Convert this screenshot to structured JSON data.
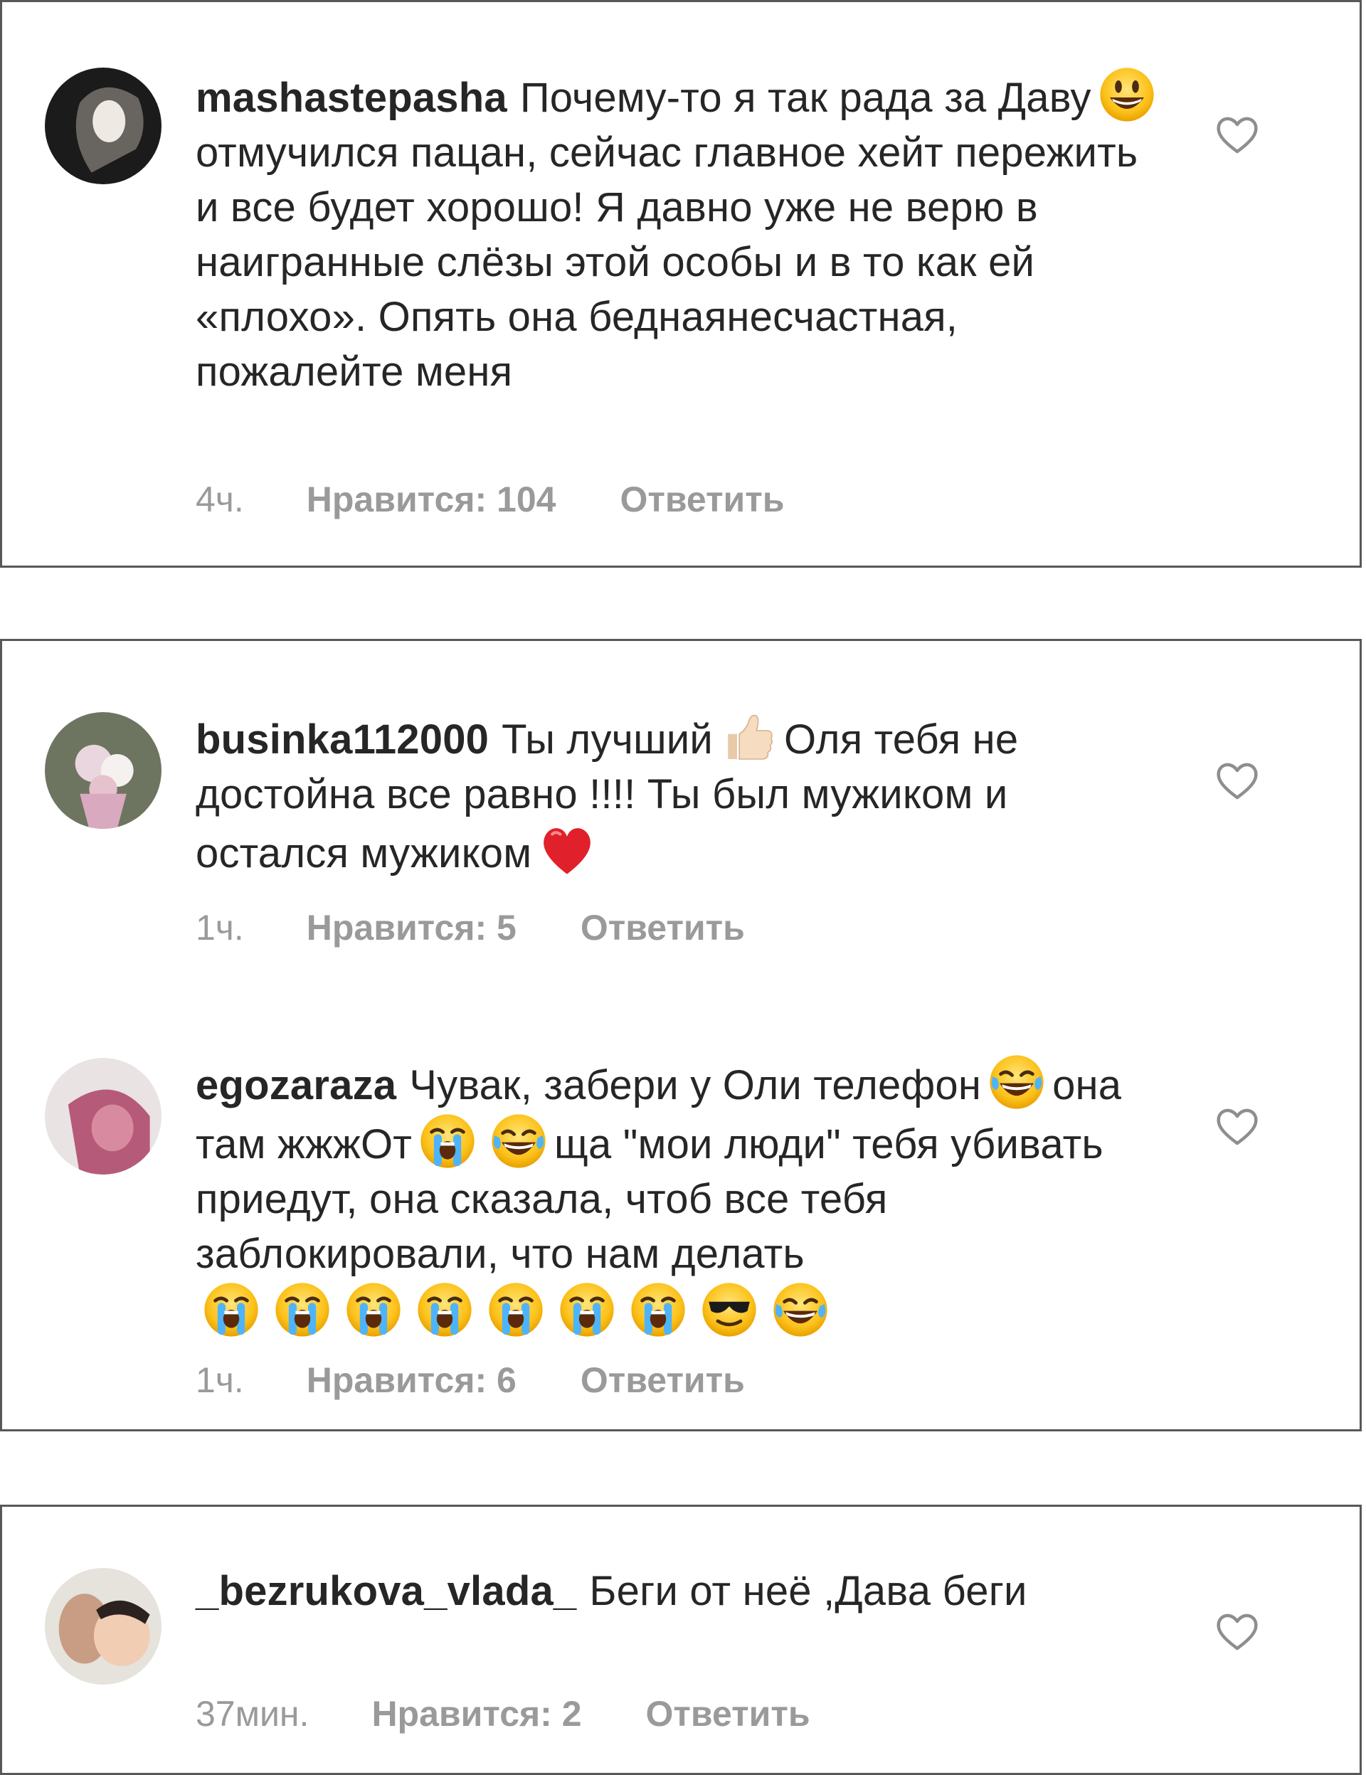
{
  "comments": [
    {
      "username": "mashastepasha",
      "text_parts": [
        "Почему-то я так рада за Даву",
        "отмучился пацан, сейчас главное хейт пережить и все будет хорошо! Я давно уже не верю в наигранные слёзы этой особы и в то как ей «плохо». Опять она беднаянесчастная, пожалейте меня"
      ],
      "emoji": [
        "smiley-emoji"
      ],
      "time": "4ч.",
      "likes": "Нравится: 104",
      "reply": "Ответить"
    },
    {
      "username": "businka112000",
      "text_parts": [
        "Ты лучший",
        "Оля тебя не достойна все равно !!!! Ты был мужиком и остался мужиком"
      ],
      "emoji": [
        "thumbs-up-emoji",
        "red-heart-emoji"
      ],
      "time": "1ч.",
      "likes": "Нравится: 5",
      "reply": "Ответить"
    },
    {
      "username": "egozaraza",
      "text_parts": [
        "Чувак, забери у Оли телефон",
        "она там жжжОт",
        "ща \"мои люди\" тебя убивать приедут, она сказала, чтоб все тебя заблокировали, что нам делать"
      ],
      "emoji": [
        "tears-of-joy-emoji",
        "loudly-crying-emoji",
        "tears-of-joy-emoji",
        "loudly-crying-emoji",
        "sunglasses-emoji",
        "tears-of-joy-emoji"
      ],
      "time": "1ч.",
      "likes": "Нравится: 6",
      "reply": "Ответить"
    },
    {
      "username": "_bezrukova_vlada_",
      "text_parts": [
        "Беги от неё ,Дава беги"
      ],
      "emoji": [],
      "time": "37мин.",
      "likes": "Нравится: 2",
      "reply": "Ответить"
    }
  ],
  "colors": {
    "text": "#262626",
    "meta": "#9a9a9a",
    "border": "#585858",
    "heart_outline": "#8e8e8e"
  }
}
